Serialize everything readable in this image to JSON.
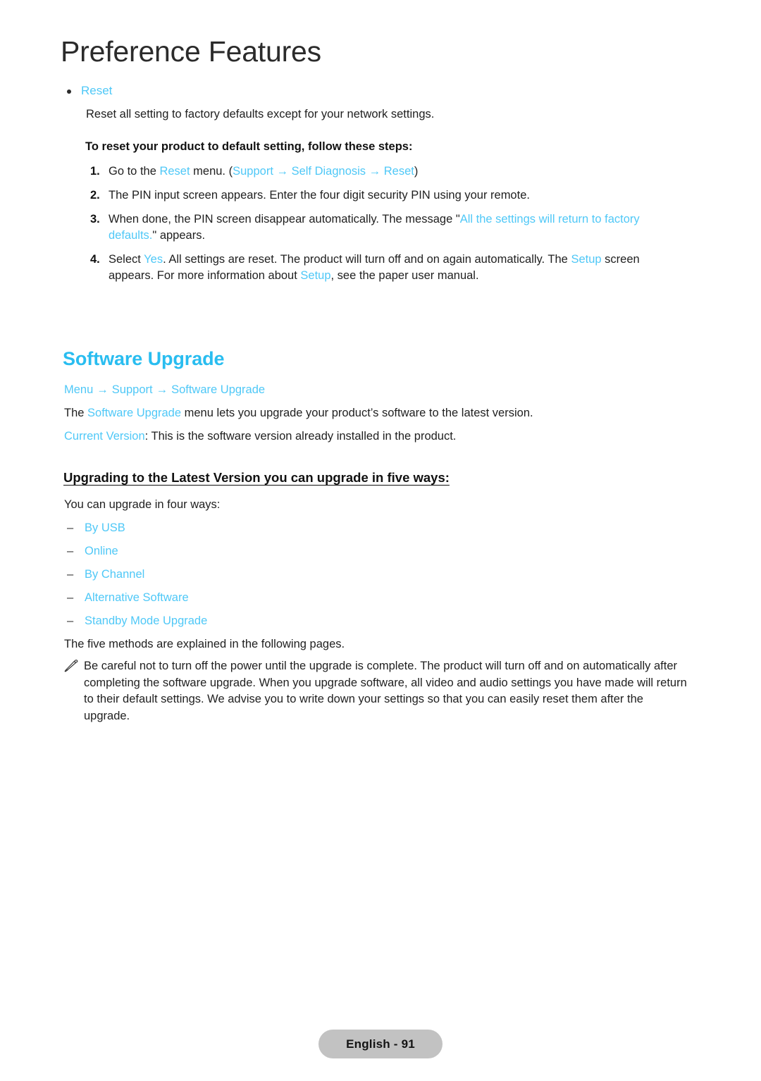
{
  "chapter": {
    "title": "Preference Features"
  },
  "reset_section": {
    "bullet_label": "Reset",
    "description": "Reset all setting to factory defaults except for your network settings.",
    "bold_lead": "To reset your product to default setting, follow these steps:",
    "steps": [
      {
        "number": "1.",
        "parts": [
          {
            "text": "Go to the ",
            "color": "dark"
          },
          {
            "text": "Reset",
            "color": "cyan"
          },
          {
            "text": " menu. (",
            "color": "dark"
          },
          {
            "text": "Support",
            "color": "cyan"
          },
          {
            "text": " → ",
            "color": "cyan"
          },
          {
            "text": "Self Diagnosis",
            "color": "cyan"
          },
          {
            "text": " → ",
            "color": "cyan"
          },
          {
            "text": "Reset",
            "color": "cyan"
          },
          {
            "text": ")",
            "color": "dark"
          }
        ]
      },
      {
        "number": "2.",
        "parts": [
          {
            "text": "The PIN input screen appears. Enter the four digit security PIN using your remote.",
            "color": "dark"
          }
        ]
      },
      {
        "number": "3.",
        "parts": [
          {
            "text": "When done, the PIN screen disappear automatically. The message \"",
            "color": "dark"
          },
          {
            "text": "All the settings will return to factory defaults.",
            "color": "cyan"
          },
          {
            "text": "\" appears.",
            "color": "dark"
          }
        ]
      },
      {
        "number": "4.",
        "parts": [
          {
            "text": "Select ",
            "color": "dark"
          },
          {
            "text": "Yes",
            "color": "cyan"
          },
          {
            "text": ". All settings are reset. The product will turn off and on again automatically. The ",
            "color": "dark"
          },
          {
            "text": "Setup",
            "color": "cyan"
          },
          {
            "text": " screen appears. For more information about ",
            "color": "dark"
          },
          {
            "text": "Setup",
            "color": "cyan"
          },
          {
            "text": ", see the paper user manual.",
            "color": "dark"
          }
        ]
      }
    ]
  },
  "software_upgrade": {
    "heading": "Software Upgrade",
    "breadcrumb": [
      "Menu",
      "Support",
      "Software Upgrade"
    ],
    "breadcrumb_arrow": "→",
    "intro_parts": [
      {
        "text": "The ",
        "color": "dark"
      },
      {
        "text": "Software Upgrade",
        "color": "cyan"
      },
      {
        "text": " menu lets you upgrade your product’s software to the latest version.",
        "color": "dark"
      }
    ],
    "current_version_parts": [
      {
        "text": "Current Version",
        "color": "cyan"
      },
      {
        "text": ": This is the software version already installed in the product.",
        "color": "dark"
      }
    ],
    "sub_heading": "Upgrading to the Latest Version you can upgrade in five ways:",
    "ways_lead": "You can upgrade in four ways:",
    "dash_mark": "–",
    "ways": [
      "By USB",
      "Online",
      "By Channel",
      "Alternative Software",
      "Standby Mode Upgrade"
    ],
    "methods_note": "The five methods are explained in the following pages.",
    "note_icon": "pencil-note-icon",
    "note_text": "Be careful not to turn off the power until the upgrade is complete. The product will turn off and on automatically after completing the software upgrade. When you upgrade software, all video and audio settings you have made will return to their default settings. We advise you to write down your settings so that you can easily reset them after the upgrade."
  },
  "footer": {
    "page_label": "English - 91"
  },
  "colors": {
    "cyan_link": "#4fc8f7",
    "cyan_heading": "#29bdf0",
    "body_text": "#1f1f1f",
    "footer_badge": "#c2c2c2"
  }
}
